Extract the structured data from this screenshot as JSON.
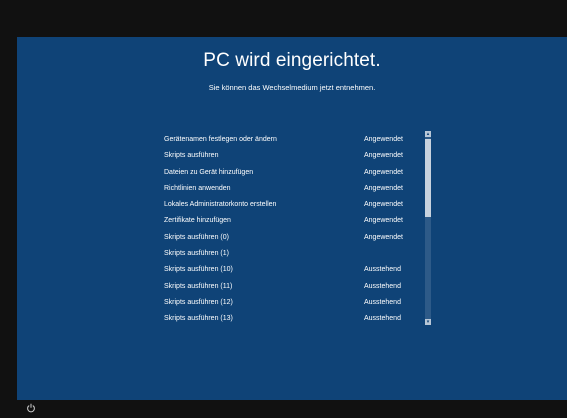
{
  "colors": {
    "screen_bg": "#0f4377",
    "frame_bg": "#111111",
    "text": "#ffffff"
  },
  "header": {
    "title": "PC wird eingerichtet.",
    "subtitle": "Sie können das Wechselmedium jetzt entnehmen."
  },
  "steps": [
    {
      "name": "Gerätenamen festlegen oder ändern",
      "status": "Angewendet"
    },
    {
      "name": "Skripts ausführen",
      "status": "Angewendet"
    },
    {
      "name": "Dateien zu Gerät hinzufügen",
      "status": "Angewendet"
    },
    {
      "name": "Richtlinien anwenden",
      "status": "Angewendet"
    },
    {
      "name": "Lokales Administratorkonto erstellen",
      "status": "Angewendet"
    },
    {
      "name": "Zertifikate hinzufügen",
      "status": "Angewendet"
    },
    {
      "name": "Skripts ausführen (0)",
      "status": "Angewendet"
    },
    {
      "name": "Skripts ausführen (1)",
      "status": ""
    },
    {
      "name": "Skripts ausführen (10)",
      "status": "Ausstehend"
    },
    {
      "name": "Skripts ausführen (11)",
      "status": "Ausstehend"
    },
    {
      "name": "Skripts ausführen (12)",
      "status": "Ausstehend"
    },
    {
      "name": "Skripts ausführen (13)",
      "status": "Ausstehend"
    }
  ],
  "icons": {
    "power": "power-icon",
    "scroll_up": "chevron-up-icon",
    "scroll_down": "chevron-down-icon"
  }
}
